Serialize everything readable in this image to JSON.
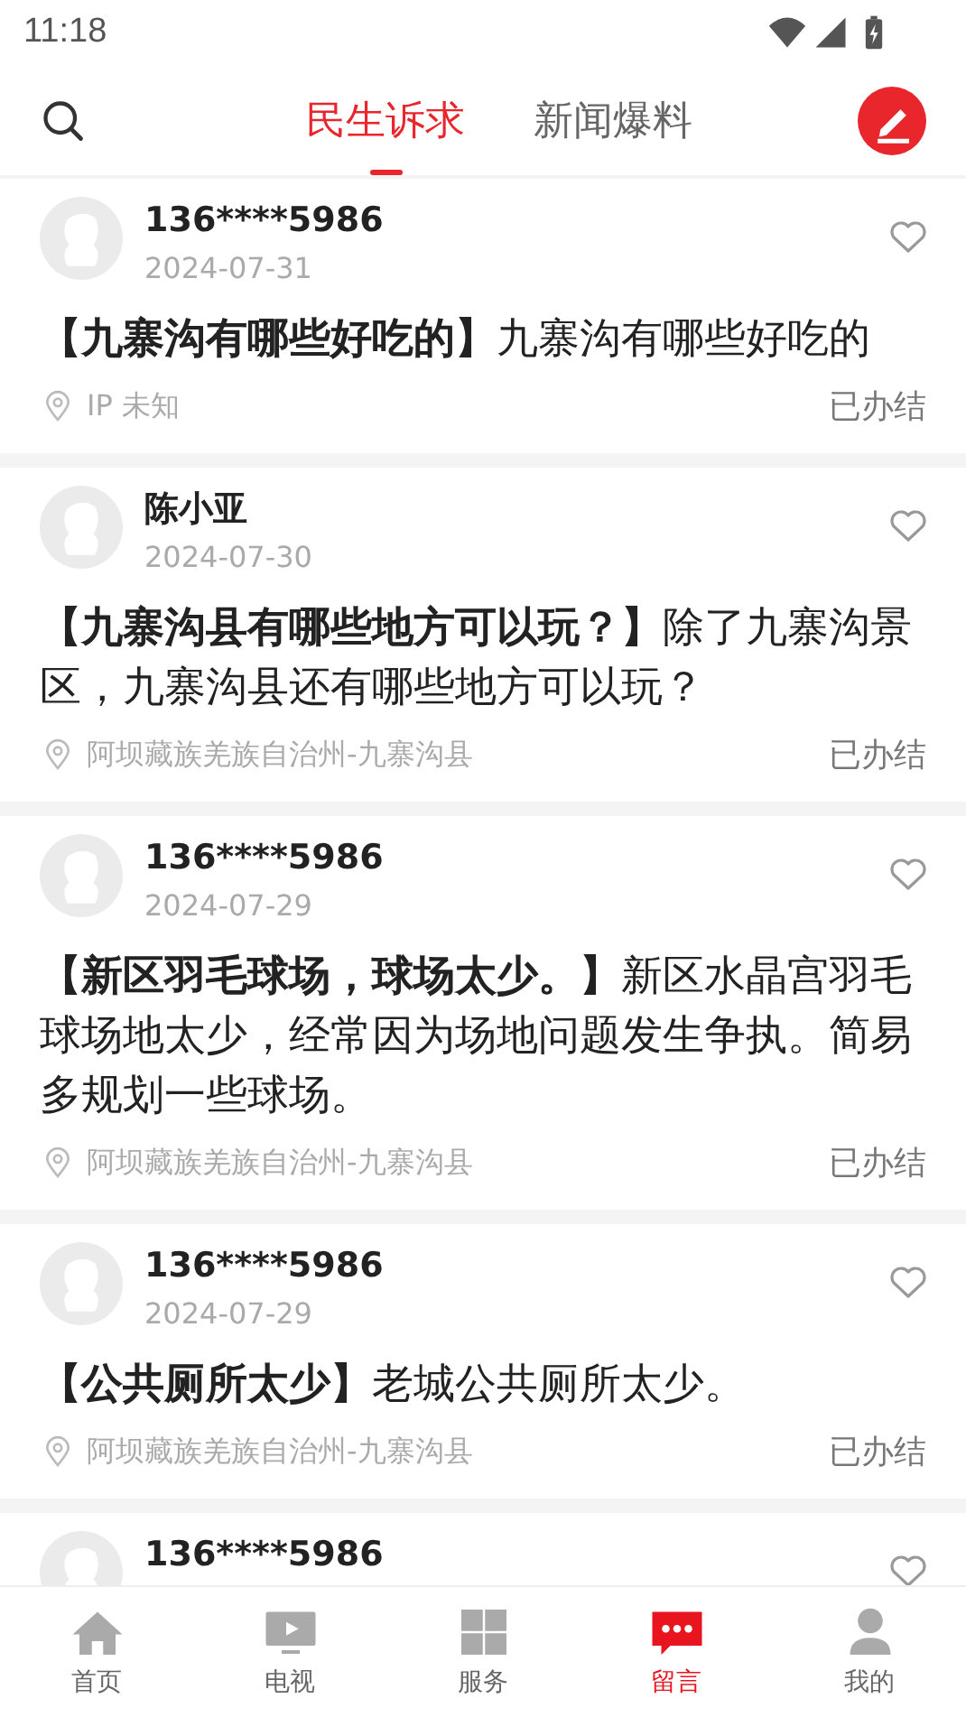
{
  "status_bar": {
    "time": "11:18"
  },
  "tabs": [
    {
      "label": "民生诉求",
      "selected": true
    },
    {
      "label": "新闻爆料",
      "selected": false
    }
  ],
  "posts": [
    {
      "user": "136****5986",
      "date": "2024-07-31",
      "text": "**【九寨沟有哪些好吃的】**九寨沟有哪些好吃的",
      "location": "IP 未知",
      "status": "已办结"
    },
    {
      "user": "陈小亚",
      "date": "2024-07-30",
      "text": "**【九寨沟县有哪些地方可以玩？】**除了九寨沟景区，九寨沟县还有哪些地方可以玩？",
      "location": "阿坝藏族羌族自治州-九寨沟县",
      "status": "已办结"
    },
    {
      "user": "136****5986",
      "date": "2024-07-29",
      "text": "**【新区羽毛球场，球场太少。】**新区水晶宫羽毛球场地太少，经常因为场地问题发生争执。简易多规划一些球场。",
      "location": "阿坝藏族羌族自治州-九寨沟县",
      "status": "已办结"
    },
    {
      "user": "136****5986",
      "date": "2024-07-29",
      "text": "**【公共厕所太少】**老城公共厕所太少。",
      "location": "阿坝藏族羌族自治州-九寨沟县",
      "status": "已办结"
    },
    {
      "user": "136****5986"
    }
  ],
  "nav": [
    {
      "label": "首页",
      "kind": "home",
      "selected": false
    },
    {
      "label": "电视",
      "kind": "tv",
      "selected": false
    },
    {
      "label": "服务",
      "kind": "grid",
      "selected": false
    },
    {
      "label": "留言",
      "kind": "message",
      "selected": true
    },
    {
      "label": "我的",
      "kind": "user",
      "selected": false
    }
  ]
}
